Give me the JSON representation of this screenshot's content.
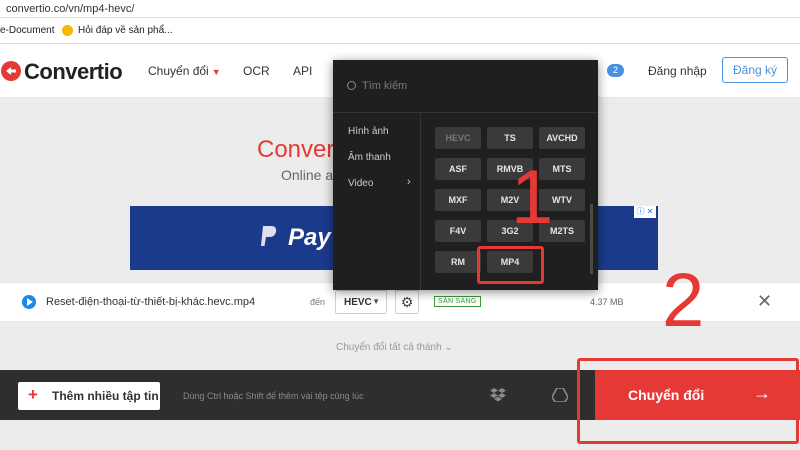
{
  "browser": {
    "url": "convertio.co/vn/mp4-hevc/",
    "bookmarks": [
      "e-Document",
      "Hỏi đáp về sản phẩ..."
    ]
  },
  "header": {
    "brand": "Convertio",
    "nav": [
      "Chuyển đổi",
      "OCR",
      "API"
    ],
    "badge_count": "2",
    "login": "Đăng nhập",
    "register": "Đăng ký"
  },
  "hero": {
    "title": "Convert",
    "subtitle": "Online ar"
  },
  "ad": {
    "brand": "Pay",
    "badge": "ⓘ ✕"
  },
  "file": {
    "name": "Reset-điện-thoại-từ-thiết-bị-khác.hevc.mp4",
    "to_label": "đến",
    "format": "HEVC",
    "status": "SẴN SÀNG",
    "size": "4.37 MB"
  },
  "convert_all": "Chuyển đổi tất cả thành",
  "bottom": {
    "add_button": "Thêm nhiều tập tin",
    "hint": "Dùng Ctrl hoặc Shift để thêm vài tệp cùng lúc",
    "convert_button": "Chuyển đổi"
  },
  "dropdown": {
    "search_placeholder": "Tìm kiếm",
    "categories": [
      "Hình ảnh",
      "Âm thanh",
      "Video"
    ],
    "formats": [
      "HEVC",
      "TS",
      "AVCHD",
      "ASF",
      "RMVB",
      "MTS",
      "MXF",
      "M2V",
      "WTV",
      "F4V",
      "3G2",
      "M2TS",
      "RM",
      "MP4"
    ]
  },
  "annotations": {
    "step1": "1",
    "step2": "2",
    "color": "#e53935"
  },
  "colors": {
    "brand_red": "#e53935",
    "accent_blue": "#4a90e2",
    "dark_bar": "#2e2e2e",
    "dropdown_bg": "#1f1f1f"
  }
}
